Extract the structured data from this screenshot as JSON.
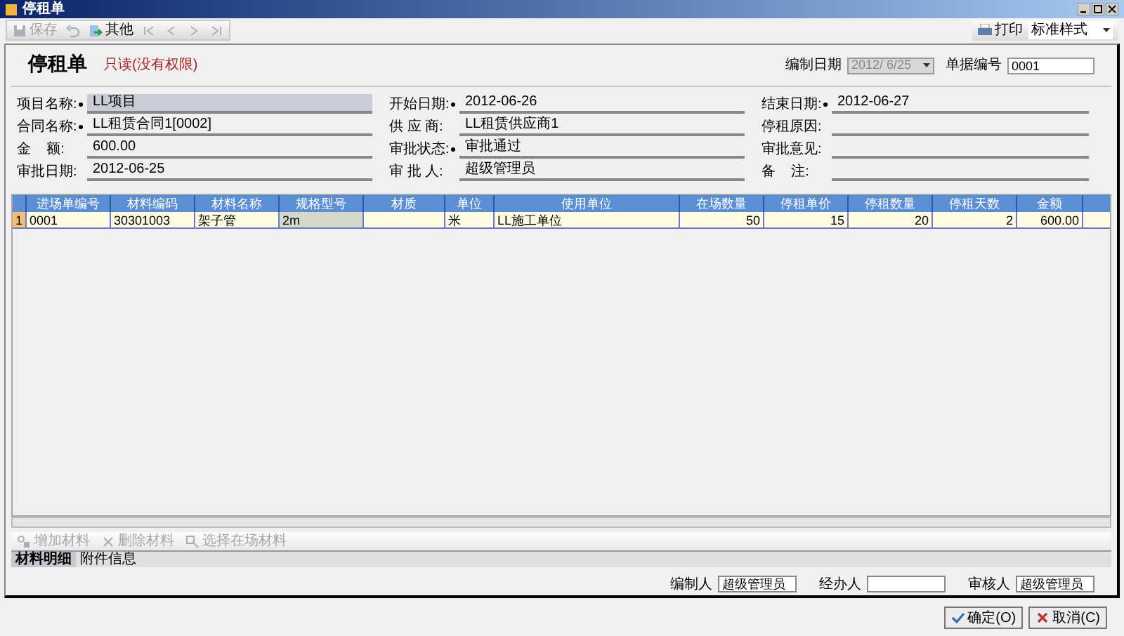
{
  "window": {
    "title": "停租单"
  },
  "toolbar": [
    {
      "kind": "save",
      "label": "保存",
      "disabled": true
    },
    {
      "kind": "undo",
      "disabled": true
    },
    {
      "kind": "menu",
      "label": "其他",
      "disabled": false
    },
    {
      "kind": "first",
      "disabled": true
    },
    {
      "kind": "prev",
      "disabled": true
    },
    {
      "kind": "next",
      "disabled": true
    },
    {
      "kind": "last",
      "disabled": true
    }
  ],
  "print": {
    "label": "打印",
    "style_value": "标准样式"
  },
  "header": {
    "title": "停租单",
    "status": "只读(没有权限)",
    "date_label": "编制日期",
    "date_value": "2012/ 6/25",
    "number_label": "单据编号",
    "number_value": "0001"
  },
  "fields": [
    {
      "label": "项目名称:",
      "required": true,
      "value": "LL项目",
      "highlighted": true
    },
    {
      "label": "开始日期:",
      "required": true,
      "value": "2012-06-26",
      "highlighted": false
    },
    {
      "label": "结束日期:",
      "required": true,
      "value": "2012-06-27",
      "highlighted": false
    },
    {
      "label": "合同名称:",
      "required": true,
      "value": "LL租赁合同1[0002]",
      "highlighted": false
    },
    {
      "label": "供 应 商:",
      "required": false,
      "value": "LL租赁供应商1",
      "highlighted": false
    },
    {
      "label": "停租原因:",
      "required": false,
      "highlighted": false
    },
    {
      "label": "金    额:",
      "required": false,
      "value": "600.00",
      "highlighted": false
    },
    {
      "label": "审批状态:",
      "required": true,
      "value": "审批通过",
      "highlighted": false
    },
    {
      "label": "审批意见:",
      "required": false,
      "highlighted": false
    },
    {
      "label": "审批日期:",
      "required": false,
      "value": "2012-06-25",
      "highlighted": false
    },
    {
      "label": "审 批 人:",
      "required": false,
      "value": "超级管理员",
      "highlighted": false
    },
    {
      "label": "备    注:",
      "required": false,
      "highlighted": false
    }
  ],
  "table": {
    "columns": [
      "进场单编号",
      "材料编码",
      "材料名称",
      "规格型号",
      "材质",
      "单位",
      "使用单位",
      "在场数量",
      "停租单价",
      "停租数量",
      "停租天数",
      "金额"
    ],
    "rows": [
      {
        "number": "1",
        "cells": [
          {
            "value": "0001",
            "selected": false
          },
          {
            "value": "30301003",
            "selected": false
          },
          {
            "value": "架子管",
            "selected": false
          },
          {
            "value": "2m",
            "selected": true
          },
          {
            "selected": false
          },
          {
            "value": "米",
            "selected": false
          },
          {
            "value": "LL施工单位",
            "selected": false
          },
          {
            "value": "50",
            "selected": false
          },
          {
            "value": "15",
            "selected": false
          },
          {
            "value": "20",
            "selected": false
          },
          {
            "value": "2",
            "selected": false
          },
          {
            "value": "600.00",
            "selected": false
          }
        ]
      }
    ]
  },
  "detail_toolbar": [
    {
      "kind": "add",
      "label": "增加材料",
      "disabled": true
    },
    {
      "kind": "delete",
      "label": "删除材料",
      "disabled": true
    },
    {
      "kind": "pick",
      "label": "选择在场材料",
      "disabled": true
    }
  ],
  "tabs": [
    {
      "label": "材料明细",
      "selected": true
    },
    {
      "label": "附件信息",
      "selected": false
    }
  ],
  "footer_fields": [
    {
      "label": "编制人",
      "value": "超级管理员"
    },
    {
      "label": "经办人"
    },
    {
      "label": "审核人",
      "value": "超级管理员"
    }
  ],
  "buttons": [
    {
      "kind": "ok",
      "label": "确定(O)"
    },
    {
      "kind": "cancel",
      "label": "取消(C)"
    }
  ]
}
